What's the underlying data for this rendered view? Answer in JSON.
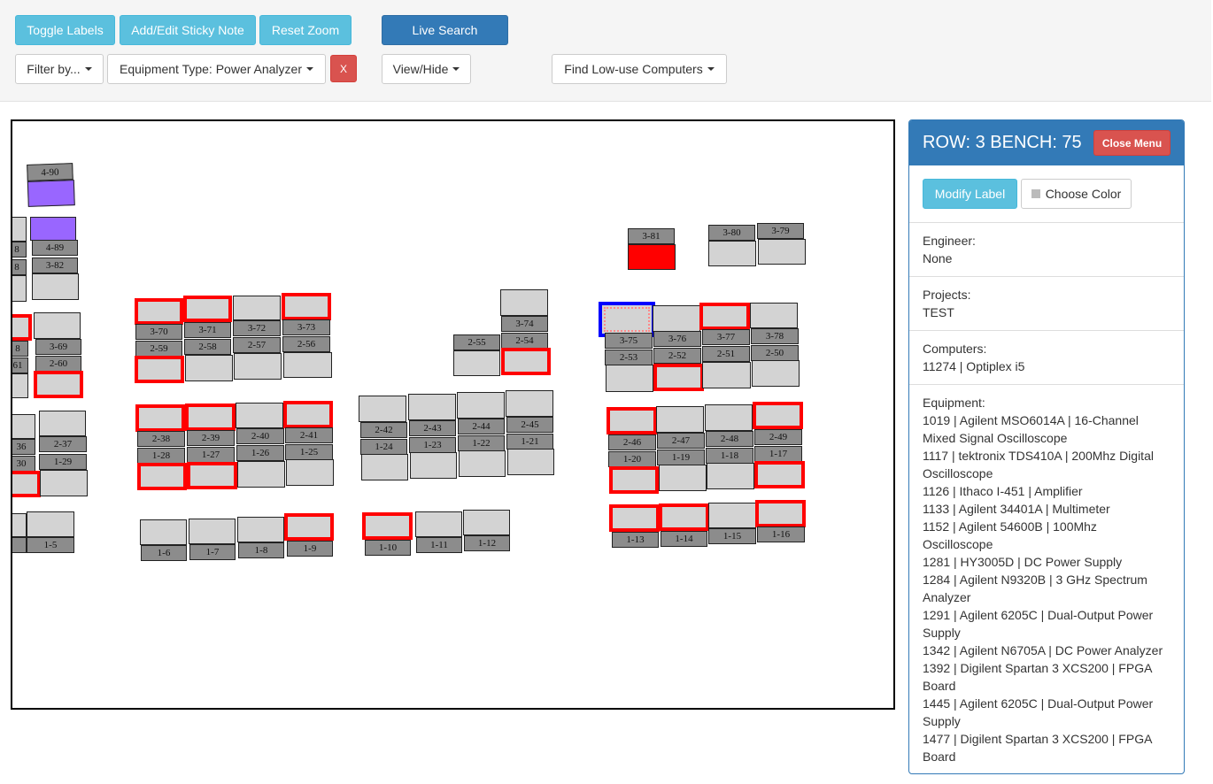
{
  "toolbar": {
    "toggle_labels": "Toggle Labels",
    "sticky_note": "Add/Edit Sticky Note",
    "reset_zoom": "Reset Zoom",
    "live_search": "Live Search",
    "filter_by": "Filter by...",
    "equipment_filter": "Equipment Type: Power Analyzer",
    "clear_filter": "X",
    "view_hide": "View/Hide",
    "low_use": "Find Low-use Computers"
  },
  "colors": {
    "primary": "#337ab7",
    "info": "#5bc0de",
    "danger": "#d9534f",
    "highlight": "#ff0000",
    "selected": "#0000ff",
    "purple": "#9966ff"
  },
  "map": {
    "labels": {
      "b4_90": "4-90",
      "b4_89": "4-89",
      "b3_82": "3-82",
      "b3_69": "3-69",
      "b2_60": "2-60",
      "b2_37": "2-37",
      "b1_29": "1-29",
      "b1_5": "1-5",
      "b3_70": "3-70",
      "b2_59": "2-59",
      "b3_71": "3-71",
      "b2_58": "2-58",
      "b3_72": "3-72",
      "b2_57": "2-57",
      "b3_73": "3-73",
      "b2_56": "2-56",
      "b2_38": "2-38",
      "b1_28": "1-28",
      "b2_39": "2-39",
      "b1_27": "1-27",
      "b2_40": "2-40",
      "b1_26": "1-26",
      "b2_41": "2-41",
      "b1_25": "1-25",
      "b1_6": "1-6",
      "b1_7": "1-7",
      "b1_8": "1-8",
      "b1_9": "1-9",
      "b2_42": "2-42",
      "b1_24": "1-24",
      "b2_43": "2-43",
      "b1_23": "1-23",
      "b2_44": "2-44",
      "b1_22": "1-22",
      "b2_45": "2-45",
      "b1_21": "1-21",
      "b1_10": "1-10",
      "b1_11": "1-11",
      "b1_12": "1-12",
      "b2_55": "2-55",
      "b3_74": "3-74",
      "b2_54": "2-54",
      "b3_81": "3-81",
      "b3_80": "3-80",
      "b3_79": "3-79",
      "b3_75": "3-75",
      "b2_53": "2-53",
      "b3_76": "3-76",
      "b2_52": "2-52",
      "b3_77": "3-77",
      "b2_51": "2-51",
      "b3_78": "3-78",
      "b2_50": "2-50",
      "b2_46": "2-46",
      "b1_20": "1-20",
      "b2_47": "2-47",
      "b1_19": "1-19",
      "b2_48": "2-48",
      "b1_18": "1-18",
      "b2_49": "2-49",
      "b1_17": "1-17",
      "b1_13": "1-13",
      "b1_14": "1-14",
      "b1_15": "1-15",
      "b1_16": "1-16",
      "p8a": "8",
      "p8b": "8",
      "p8c": "8",
      "p61": "61",
      "p36": "36",
      "p30": "30"
    }
  },
  "panel": {
    "title": "ROW: 3 BENCH: 75",
    "close": "Close Menu",
    "modify_label": "Modify Label",
    "choose_color": "Choose Color",
    "engineer_label": "Engineer:",
    "engineer_value": "None",
    "projects_label": "Projects:",
    "projects_value": "TEST",
    "computers_label": "Computers:",
    "computers_value": "11274 | Optiplex i5",
    "equipment_label": "Equipment:",
    "equipment": [
      "1019 | Agilent MSO6014A | 16-Channel Mixed Signal Oscilloscope",
      "1117 | tektronix TDS410A | 200Mhz Digital Oscilloscope",
      "1126 | Ithaco I-451 | Amplifier",
      "1133 | Agilent 34401A | Multimeter",
      "1152 | Agilent 54600B | 100Mhz Oscilloscope",
      "1281 | HY3005D | DC Power Supply",
      "1284 | Agilent N9320B | 3 GHz Spectrum Analyzer",
      "1291 | Agilent 6205C | Dual-Output Power Supply",
      "1342 | Agilent N6705A | DC Power Analyzer",
      "1392 | Digilent Spartan 3 XCS200 | FPGA Board",
      "1445 | Agilent 6205C | Dual-Output Power Supply",
      "1477 | Digilent Spartan 3 XCS200 | FPGA Board"
    ]
  }
}
